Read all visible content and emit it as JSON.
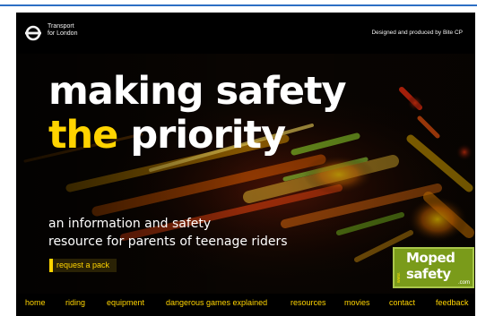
{
  "header": {
    "brand_line1": "Transport",
    "brand_line2": "for London",
    "credit": "Designed and produced by Bite CP"
  },
  "hero": {
    "headline_line1": "making safety",
    "headline_yellow": "the",
    "headline_rest": "priority",
    "subtitle_line1": "an information and safety",
    "subtitle_line2": "resource for parents of teenage riders",
    "cta_label": "request a pack"
  },
  "logo": {
    "side_text": "www.",
    "word1": "Moped",
    "word2": "safety",
    "tld": ".com"
  },
  "nav": {
    "items": [
      "home",
      "riding",
      "equipment",
      "dangerous games explained",
      "resources",
      "movies",
      "contact",
      "feedback"
    ]
  },
  "colors": {
    "accent": "#ffd400",
    "background": "#000000",
    "tfl_blue": "#2d6fc4"
  }
}
